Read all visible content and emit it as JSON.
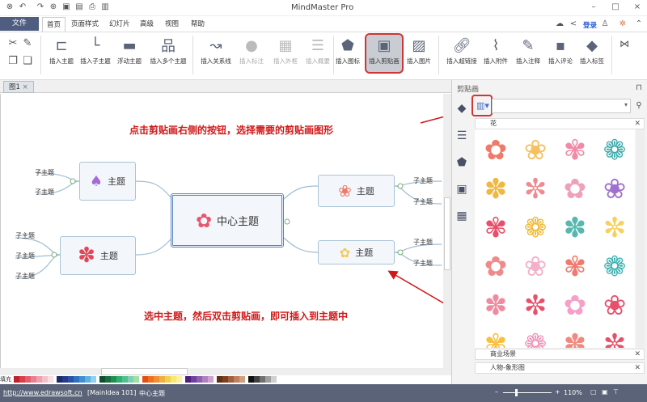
{
  "title": "MindMaster Pro",
  "menu": {
    "file": "文件",
    "tabs": [
      "首页",
      "页面样式",
      "幻灯片",
      "高级",
      "视图",
      "帮助"
    ],
    "login": "登录"
  },
  "ribbon": {
    "buttons": [
      "插入主题",
      "插入子主题",
      "浮动主题",
      "插入多个主题",
      "插入关系线",
      "插入标注",
      "插入外框",
      "插入概要",
      "插入图标",
      "插入剪贴画",
      "插入图片",
      "插入超链接",
      "插入附件",
      "插入注释",
      "插入评论",
      "插入标签"
    ]
  },
  "doc_tab": "图1",
  "panel": {
    "title": "剪贴画",
    "categories": [
      "花",
      "商业场景",
      "人物-象形图"
    ]
  },
  "mindmap": {
    "central": "中心主题",
    "topic": "主题",
    "subtopic": "子主题"
  },
  "annotations": {
    "top": "点击剪贴画右侧的按钮，选择需要的剪贴画图形",
    "bottom": "选中主题，然后双击剪贴画，即可插入到主题中",
    "color": "#d01818"
  },
  "status": {
    "url": "http://www.edrawsoft.cn",
    "info": "[MainIdea 101]",
    "selection": "中心主题",
    "zoom": "110%",
    "fill_label": "填充"
  }
}
